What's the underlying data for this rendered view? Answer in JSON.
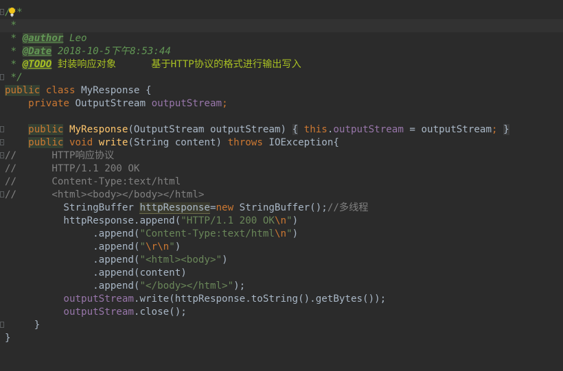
{
  "lines": [
    {
      "id": "l1",
      "text": "/**"
    },
    {
      "id": "l2",
      "text": " *"
    },
    {
      "id": "l3a",
      "text": " * "
    },
    {
      "id": "l3b",
      "text": "@author"
    },
    {
      "id": "l3c",
      "text": " Leo"
    },
    {
      "id": "l4a",
      "text": " * "
    },
    {
      "id": "l4b",
      "text": "@Date"
    },
    {
      "id": "l4c",
      "text": " 2018-10-5下午8:53:44"
    },
    {
      "id": "l5a",
      "text": " * "
    },
    {
      "id": "l5b",
      "text": "@TODO"
    },
    {
      "id": "l5c",
      "text": " 封装响应对象      基于HTTP协议的格式进行输出写入"
    },
    {
      "id": "l6",
      "text": " */"
    }
  ],
  "code": {
    "class_decl": {
      "kw1": "public",
      "kw2": "class",
      "name": "MyResponse {"
    },
    "field": {
      "kw": "private",
      "type": "OutputStream",
      "name": "outputStream",
      "semi": ";"
    },
    "ctor": {
      "kw": "public",
      "name": "MyResponse",
      "params": "(OutputStream outputStream)",
      "body_open": "{",
      "this": "this",
      "dot": ".",
      "field": "outputStream",
      "assign": " = outputStream",
      "semi": ";",
      "body_close": "}"
    },
    "write": {
      "kw1": "public",
      "kw2": "void",
      "name": "write",
      "params": "(String content) ",
      "throws": "throws",
      "exc": " IOException{"
    },
    "comments": [
      "//      HTTP响应协议",
      "//      HTTP/1.1 200 OK",
      "//      Content-Type:text/html",
      "//      <html><body></body></html>"
    ],
    "sb_line": {
      "type": "StringBuffer ",
      "var": "httpResponse",
      "eq": "=",
      "new": "new",
      "rest": " StringBuffer();",
      "cmt": "//多线程"
    },
    "append1": {
      "pre": "httpResponse.append(",
      "str": "\"HTTP/1.1 200 OK",
      "esc": "\\n",
      "end": "\"",
      "close": ")"
    },
    "append2": {
      "pre": ".append(",
      "str": "\"Content-Type:text/html",
      "esc": "\\n",
      "end": "\"",
      "close": ")"
    },
    "append3": {
      "pre": ".append(",
      "str1": "\"",
      "esc": "\\r\\n",
      "str2": "\"",
      "close": ")"
    },
    "append4": {
      "pre": ".append(",
      "str": "\"<html><body>\"",
      "close": ")"
    },
    "append5": {
      "text": ".append(content)"
    },
    "append6": {
      "pre": ".append(",
      "str": "\"</body></html>\"",
      "close": ");"
    },
    "os_write": {
      "fld": "outputStream",
      "rest": ".write(httpResponse.toString().getBytes());"
    },
    "os_close": {
      "fld": "outputStream",
      "rest": ".close();"
    },
    "close_method": "}",
    "close_class": "}"
  },
  "colors": {
    "background": "#2b2b2b",
    "keyword": "#cc7832",
    "doc": "#629755",
    "string": "#6a8759",
    "field": "#9876aa",
    "method": "#ffc66d",
    "comment": "#808080"
  }
}
